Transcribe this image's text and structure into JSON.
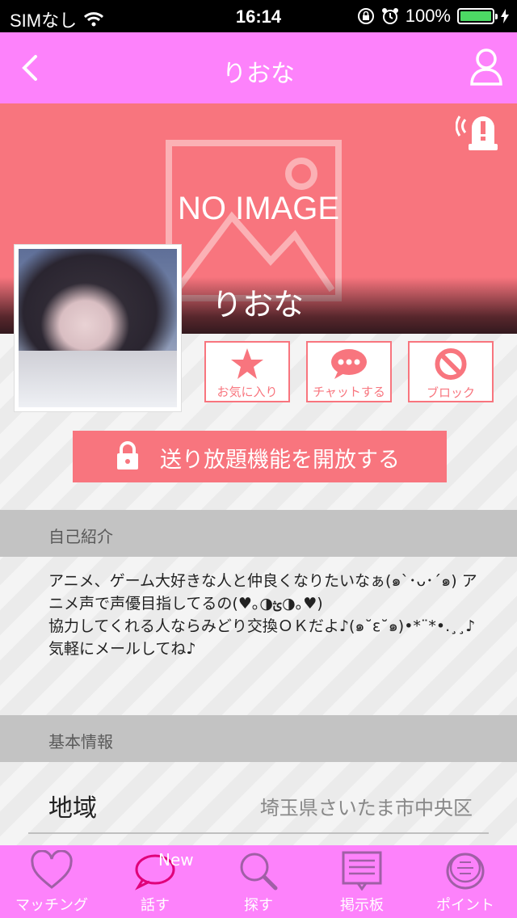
{
  "status_bar": {
    "carrier": "SIMなし",
    "time": "16:14",
    "battery": "100%"
  },
  "nav": {
    "title": "りおな"
  },
  "hero": {
    "placeholder_text": "NO IMAGE",
    "name": "りおな"
  },
  "actions": {
    "favorite": "お気に入り",
    "chat": "チャットする",
    "block": "ブロック"
  },
  "unlock_button": "送り放題機能を開放する",
  "self_intro": {
    "header": "自己紹介",
    "text": "アニメ、ゲーム大好きな人と仲良くなりたいなぁ(๑`･ᴗ･´๑) アニメ声で声優目指してるの(♥｡◑ؿ◑｡♥)\n協力してくれる人ならみどり交換ＯＫだよ♪(๑˘ε˘๑)•*¨*•.¸¸♪ 気軽にメールしてね♪"
  },
  "basic_info": {
    "header": "基本情報",
    "rows": [
      {
        "key": "地域",
        "value": "埼玉県さいたま市中央区"
      }
    ]
  },
  "tabs": [
    {
      "label": "マッチング",
      "icon": "heart-icon"
    },
    {
      "label": "話す",
      "icon": "speech-bubble-icon",
      "badge": "New"
    },
    {
      "label": "探す",
      "icon": "magnifier-icon"
    },
    {
      "label": "掲示板",
      "icon": "bulletin-board-icon"
    },
    {
      "label": "ポイント",
      "icon": "coin-icon"
    }
  ],
  "colors": {
    "brand_pink": "#fd82fb",
    "accent_coral": "#f8757e",
    "battery_green": "#4cd964"
  }
}
